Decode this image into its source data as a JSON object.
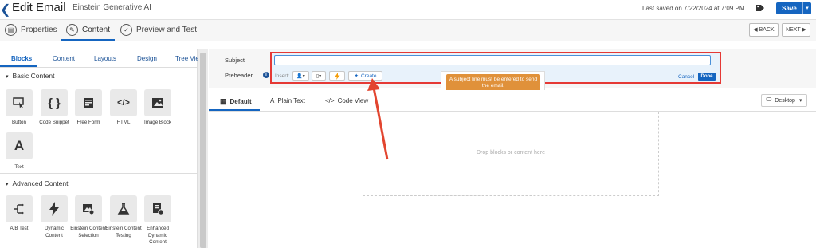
{
  "header": {
    "title": "Edit Email",
    "subtitle": "Einstein Generative AI",
    "last_saved": "Last saved on 7/22/2024 at 7:09 PM",
    "save_label": "Save"
  },
  "steps": [
    {
      "label": "Properties"
    },
    {
      "label": "Content"
    },
    {
      "label": "Preview and Test"
    }
  ],
  "nav": {
    "back": "◀ BACK",
    "next": "NEXT ▶"
  },
  "left_panel": {
    "tabs": [
      "Blocks",
      "Content",
      "Layouts",
      "Design",
      "Tree View"
    ],
    "basic_section": "Basic Content",
    "advanced_section": "Advanced Content",
    "basic_blocks": [
      {
        "label": "Button",
        "icon": "button-icon"
      },
      {
        "label": "Code Snippet",
        "icon": "code-snippet-icon"
      },
      {
        "label": "Free Form",
        "icon": "free-form-icon"
      },
      {
        "label": "HTML",
        "icon": "html-icon"
      },
      {
        "label": "Image Block",
        "icon": "image-icon"
      },
      {
        "label": "Text",
        "icon": "text-icon"
      }
    ],
    "advanced_blocks": [
      {
        "label": "A/B Test",
        "icon": "ab-test-icon"
      },
      {
        "label": "Dynamic Content",
        "icon": "lightning-icon"
      },
      {
        "label": "Einstein Content Selection",
        "icon": "einstein-selection-icon"
      },
      {
        "label": "Einstein Content Testing",
        "icon": "flask-icon"
      },
      {
        "label": "Enhanced Dynamic Content",
        "icon": "enhanced-dynamic-icon"
      }
    ]
  },
  "form": {
    "subject_label": "Subject",
    "preheader_label": "Preheader",
    "subject_value": "",
    "insert_label": "Insert:",
    "create_label": "Create",
    "tooltip": "A subject line must be entered to send the email.",
    "cancel": "Cancel",
    "done": "Done"
  },
  "view_tabs": [
    {
      "label": "Default"
    },
    {
      "label": "Plain Text"
    },
    {
      "label": "Code View"
    }
  ],
  "device": "Desktop",
  "canvas": {
    "placeholder": "Drop blocks or content here"
  },
  "colors": {
    "accent": "#1565c0",
    "highlight": "#e53935",
    "tooltip": "#e0913a"
  }
}
